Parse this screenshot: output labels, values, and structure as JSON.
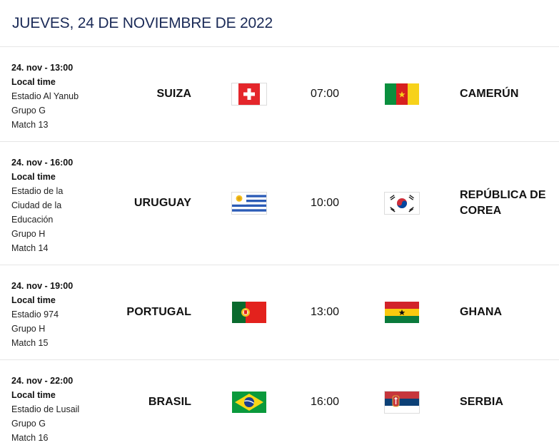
{
  "header": {
    "title": "JUEVES, 24 DE NOVIEMBRE DE 2022"
  },
  "matches": [
    {
      "when": "24. nov - 13:00",
      "local": "Local time",
      "stadium": "Estadio Al Yanub",
      "group": "Grupo G",
      "match": "Match 13",
      "home": "SUIZA",
      "home_flag": "switzerland-flag-icon",
      "time": "07:00",
      "away": "CAMERÚN",
      "away_flag": "cameroon-flag-icon"
    },
    {
      "when": "24. nov - 16:00",
      "local": "Local time",
      "stadium": "Estadio de la Ciudad de la Educación",
      "group": "Grupo H",
      "match": "Match 14",
      "home": "URUGUAY",
      "home_flag": "uruguay-flag-icon",
      "time": "10:00",
      "away": "REPÚBLICA DE COREA",
      "away_flag": "south-korea-flag-icon"
    },
    {
      "when": "24. nov - 19:00",
      "local": "Local time",
      "stadium": "Estadio 974",
      "group": "Grupo H",
      "match": "Match 15",
      "home": "PORTUGAL",
      "home_flag": "portugal-flag-icon",
      "time": "13:00",
      "away": "GHANA",
      "away_flag": "ghana-flag-icon"
    },
    {
      "when": "24. nov - 22:00",
      "local": "Local time",
      "stadium": "Estadio de Lusail",
      "group": "Grupo G",
      "match": "Match 16",
      "home": "BRASIL",
      "home_flag": "brazil-flag-icon",
      "time": "16:00",
      "away": "SERBIA",
      "away_flag": "serbia-flag-icon"
    }
  ]
}
